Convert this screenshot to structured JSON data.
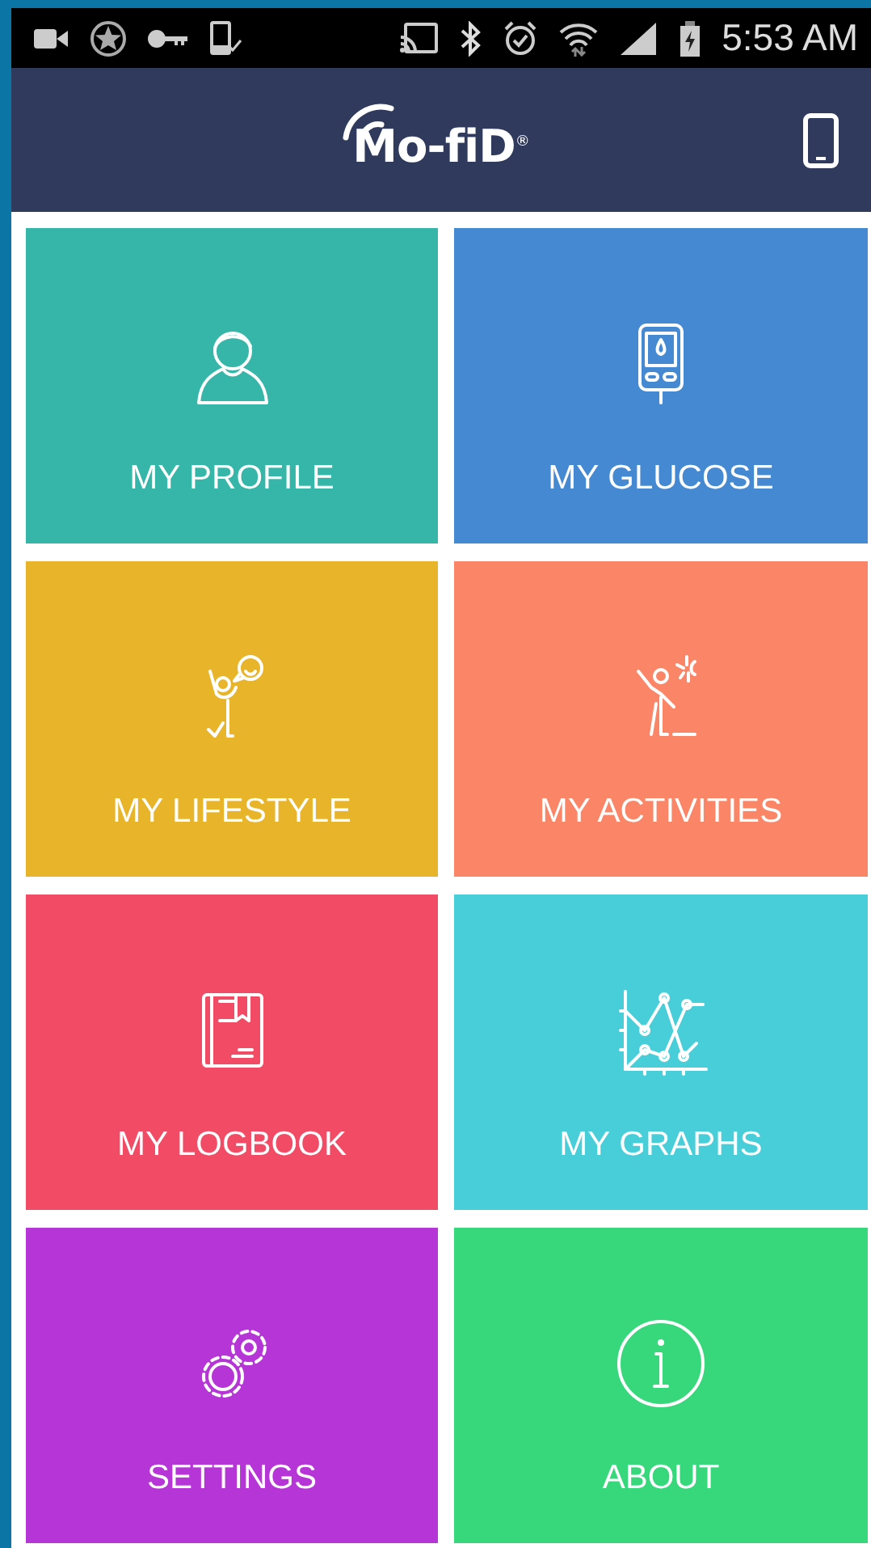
{
  "status_bar": {
    "time": "5:53 AM"
  },
  "header": {
    "logo": "Mo-fiD",
    "logo_mark": "®"
  },
  "tiles": [
    {
      "label": "MY PROFILE",
      "kind": "profile",
      "color": "#35b6a8"
    },
    {
      "label": "MY GLUCOSE",
      "kind": "glucose",
      "color": "#4689d3"
    },
    {
      "label": "MY LIFESTYLE",
      "kind": "lifestyle",
      "color": "#e8b52a"
    },
    {
      "label": "MY ACTIVITIES",
      "kind": "activities",
      "color": "#fb8667"
    },
    {
      "label": "MY LOGBOOK",
      "kind": "logbook",
      "color": "#f24b65"
    },
    {
      "label": "MY GRAPHS",
      "kind": "graphs",
      "color": "#47ced9"
    },
    {
      "label": "SETTINGS",
      "kind": "settings",
      "color": "#b535d6"
    },
    {
      "label": "ABOUT",
      "kind": "about",
      "color": "#37d87c"
    }
  ]
}
